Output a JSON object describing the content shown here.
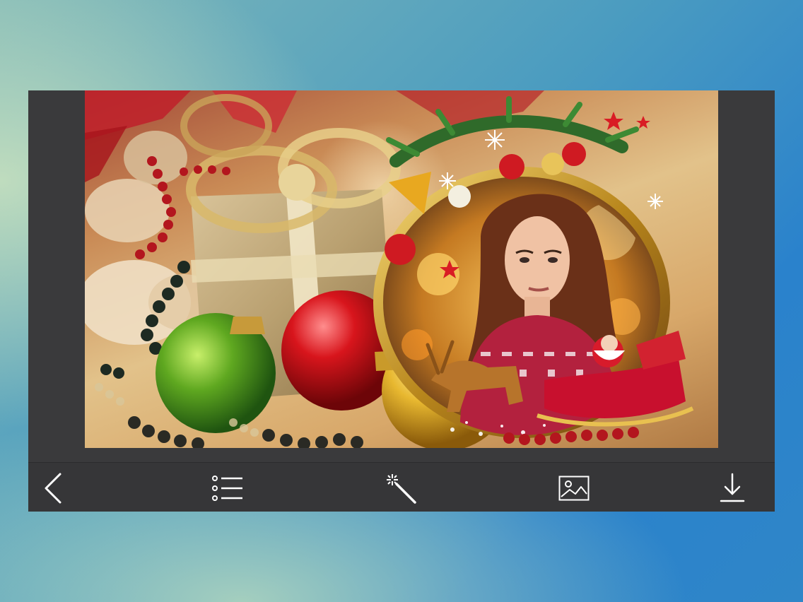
{
  "app": {
    "toolbar": {
      "items": [
        {
          "id": "back",
          "icon": "chevron-left-icon"
        },
        {
          "id": "frames",
          "icon": "list-icon"
        },
        {
          "id": "effects",
          "icon": "magic-wand-icon"
        },
        {
          "id": "gallery",
          "icon": "image-icon"
        },
        {
          "id": "save",
          "icon": "download-icon"
        }
      ]
    },
    "canvas": {
      "photo": "christmas-frame-photo",
      "subject": "portrait-photo"
    },
    "colors": {
      "toolbar_bg": "#363638",
      "device_bg": "#3a3a3c",
      "icon_color": "#ffffff"
    }
  }
}
